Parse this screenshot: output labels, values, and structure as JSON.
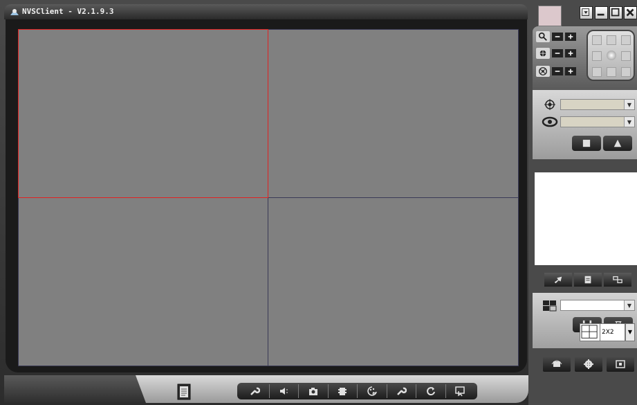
{
  "window": {
    "title": "NVSClient - V2.1.9.3"
  },
  "colors": {
    "selected_pane_border": "#e22222",
    "pane_background": "#808080",
    "pane_divider": "#3a3a56",
    "color_swatch": "#dcc8cc"
  },
  "video": {
    "panes": [
      "pane-1",
      "pane-2",
      "pane-3",
      "pane-4"
    ],
    "selected_pane": 1
  },
  "toolbar": {
    "icons": [
      "wrench-icon",
      "speaker-icon",
      "camera-icon",
      "record-icon",
      "color-palette-icon",
      "settings-wrench-icon",
      "refresh-icon",
      "exit-icon"
    ]
  },
  "ptz": {
    "rows": [
      "zoom-icon",
      "focus-icon",
      "iris-icon"
    ]
  },
  "controls": {
    "preset_select": "",
    "cruise_select": ""
  },
  "layout": {
    "scheme_select": "",
    "split_mode": "2X2"
  }
}
